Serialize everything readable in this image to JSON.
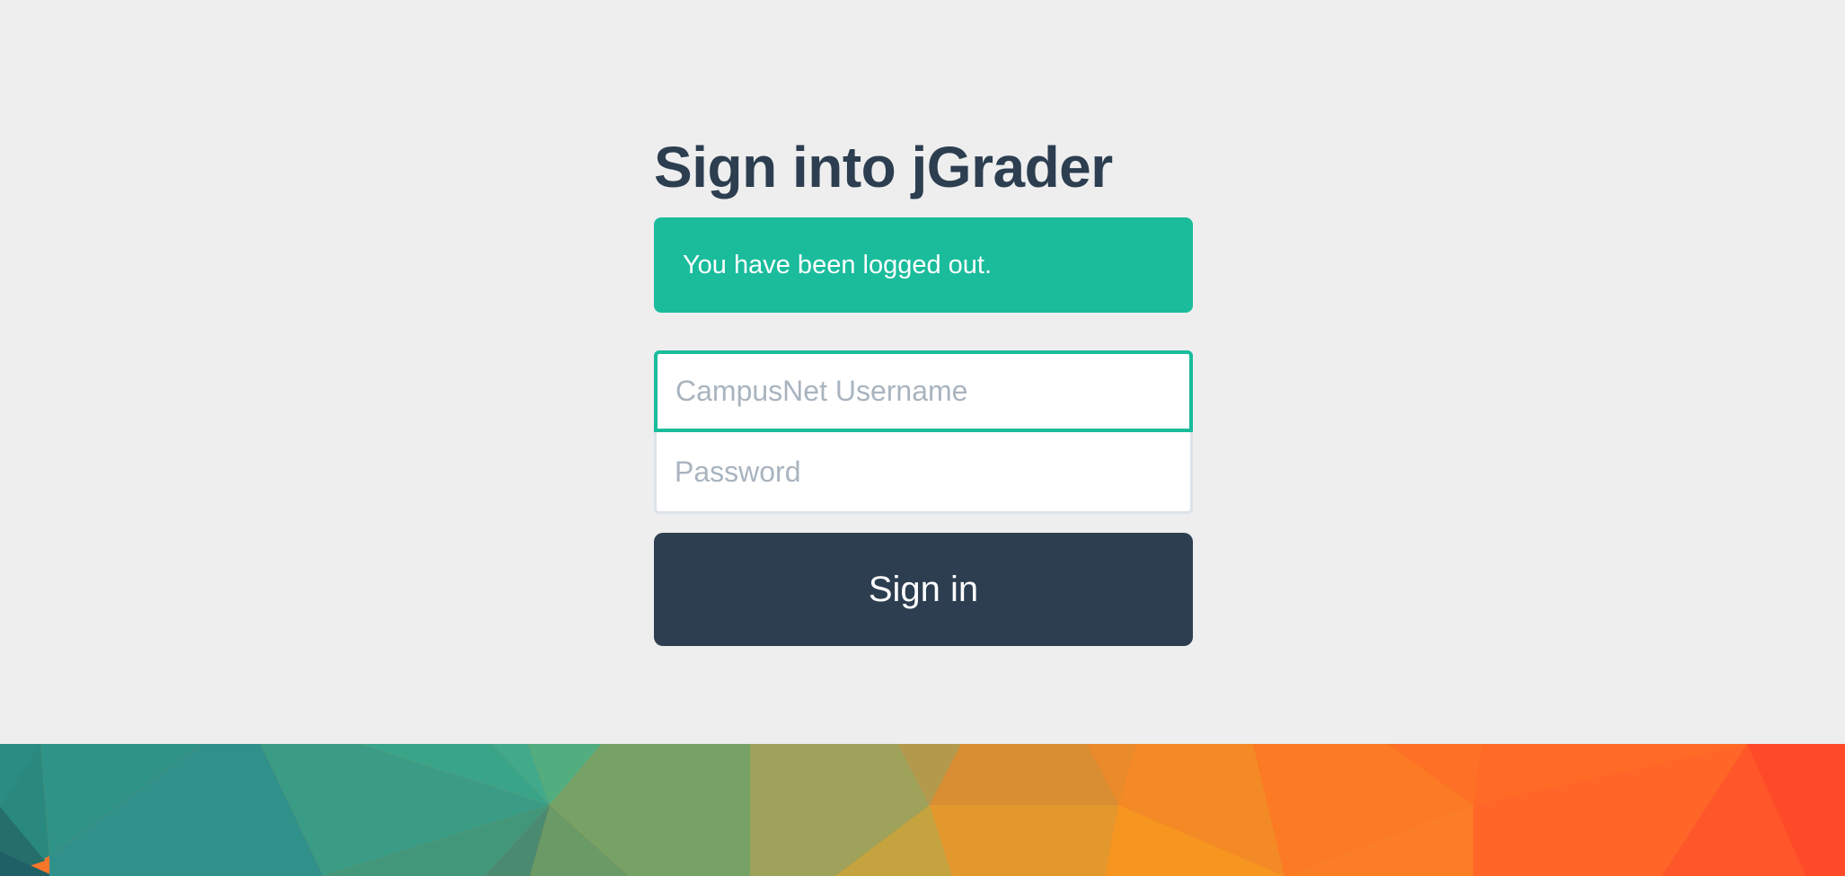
{
  "title": "Sign into jGrader",
  "alert": {
    "message": "You have been logged out.",
    "color": "#1abc9c"
  },
  "form": {
    "username_placeholder": "CampusNet Username",
    "password_placeholder": "Password",
    "username_value": "",
    "password_value": "",
    "submit_label": "Sign in"
  },
  "colors": {
    "background": "#eeeeee",
    "accent": "#1abc9c",
    "primary": "#2c3e50"
  }
}
